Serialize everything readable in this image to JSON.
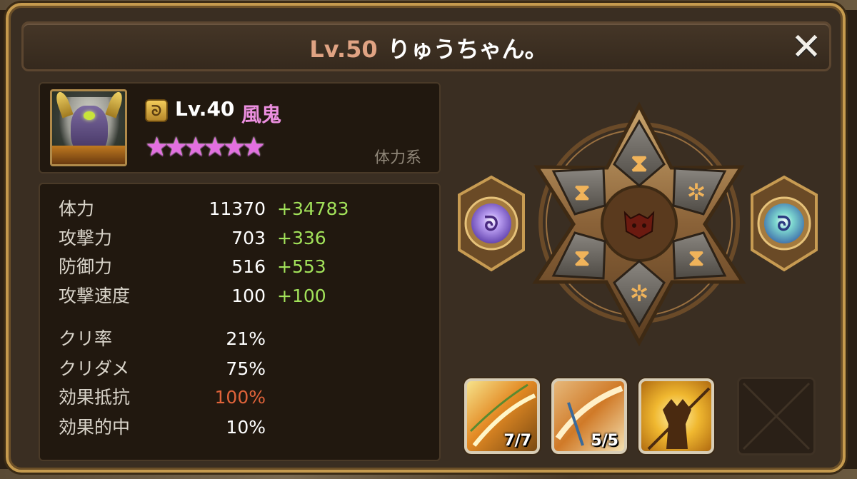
{
  "header": {
    "level": "Lv.50",
    "name": "りゅうちゃん。",
    "close_icon": "close-x-icon"
  },
  "monster": {
    "level": "Lv.40",
    "name": "風鬼",
    "type": "体力系",
    "stars": "★★★★★★",
    "star_count": 6,
    "awaken_icon": "wind-swirl-icon"
  },
  "stats": [
    {
      "label": "体力",
      "value": "11370",
      "bonus": "+34783"
    },
    {
      "label": "攻撃力",
      "value": "703",
      "bonus": "+336"
    },
    {
      "label": "防御力",
      "value": "516",
      "bonus": "+553"
    },
    {
      "label": "攻撃速度",
      "value": "100",
      "bonus": "+100"
    },
    {
      "label": "クリ率",
      "value": "21%",
      "bonus": ""
    },
    {
      "label": "クリダメ",
      "value": "75%",
      "bonus": ""
    },
    {
      "label": "効果抵抗",
      "value": "100%",
      "bonus": ""
    },
    {
      "label": "効果的中",
      "value": "10%",
      "bonus": ""
    }
  ],
  "colors": {
    "title_level": "#e0a383",
    "monster_name": "#ec8fe0",
    "bonus": "#a2e25a",
    "highlight_value": "#e0633a",
    "frame_gold": "#c59a4e"
  },
  "runes": {
    "slots": [
      "hourglass-rune-icon",
      "star-rune-icon",
      "hourglass-rune-icon",
      "star-rune-icon",
      "hourglass-rune-icon",
      "hourglass-rune-icon"
    ],
    "center_icon": "demon-crest-icon",
    "left_artifact": "purple-swirl-artifact-icon",
    "right_artifact": "teal-swirl-artifact-icon"
  },
  "skills": [
    {
      "icon": "wind-slash-skill-icon",
      "count": "7/7"
    },
    {
      "icon": "sword-sweep-skill-icon",
      "count": "5/5"
    },
    {
      "icon": "spear-warrior-skill-icon",
      "count": ""
    }
  ]
}
